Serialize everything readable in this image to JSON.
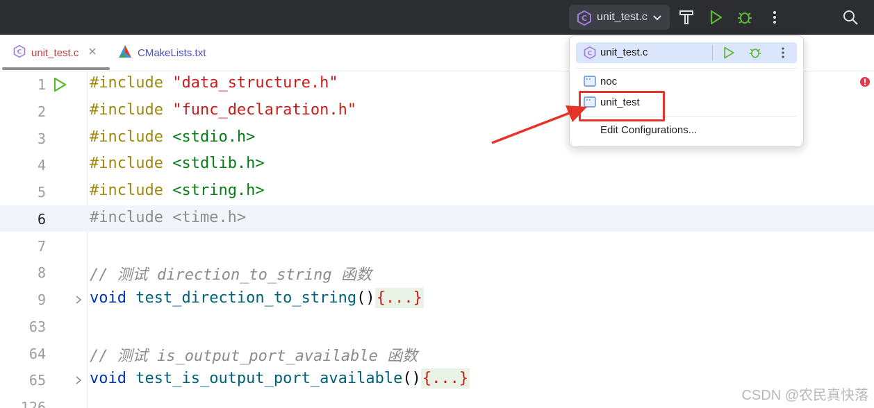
{
  "toolbar": {
    "run_config_label": "unit_test.c"
  },
  "tabs": [
    {
      "label": "unit_test.c",
      "active": true
    },
    {
      "label": "CMakeLists.txt",
      "active": false
    }
  ],
  "editor": {
    "lines": [
      {
        "num": "1"
      },
      {
        "num": "2"
      },
      {
        "num": "3"
      },
      {
        "num": "4"
      },
      {
        "num": "5"
      },
      {
        "num": "6"
      },
      {
        "num": "7"
      },
      {
        "num": "8"
      },
      {
        "num": "9"
      },
      {
        "num": "63"
      },
      {
        "num": "64"
      },
      {
        "num": "65"
      },
      {
        "num": "126"
      }
    ],
    "code": {
      "l1_kw": "#include",
      "l1_str": "\"data_structure.h\"",
      "l2_kw": "#include",
      "l2_str": "\"func_declaration.h\"",
      "l3_kw": "#include",
      "l3_sys": "<stdio.h>",
      "l4_kw": "#include",
      "l4_sys": "<stdlib.h>",
      "l5_kw": "#include",
      "l5_sys": "<string.h>",
      "l6_text": "#include <time.h>",
      "l8_comment": "// 测试 direction_to_string 函数",
      "l9_kw": "void",
      "l9_fn": "test_direction_to_string",
      "l9_parens": "()",
      "l9_fold": "{...}",
      "l64_comment": "// 测试 is_output_port_available 函数",
      "l65_kw": "void",
      "l65_fn": "test_is_output_port_available",
      "l65_parens": "()",
      "l65_fold": "{...}"
    }
  },
  "popup": {
    "header_label": "unit_test.c",
    "items": [
      {
        "label": "noc"
      },
      {
        "label": "unit_test"
      }
    ],
    "edit_configurations": "Edit Configurations..."
  },
  "watermark": "CSDN @农民真快落",
  "colors": {
    "toolbar_bg": "#2b2d30",
    "run_green": "#5fb832",
    "annotation_red": "#e5332a"
  }
}
